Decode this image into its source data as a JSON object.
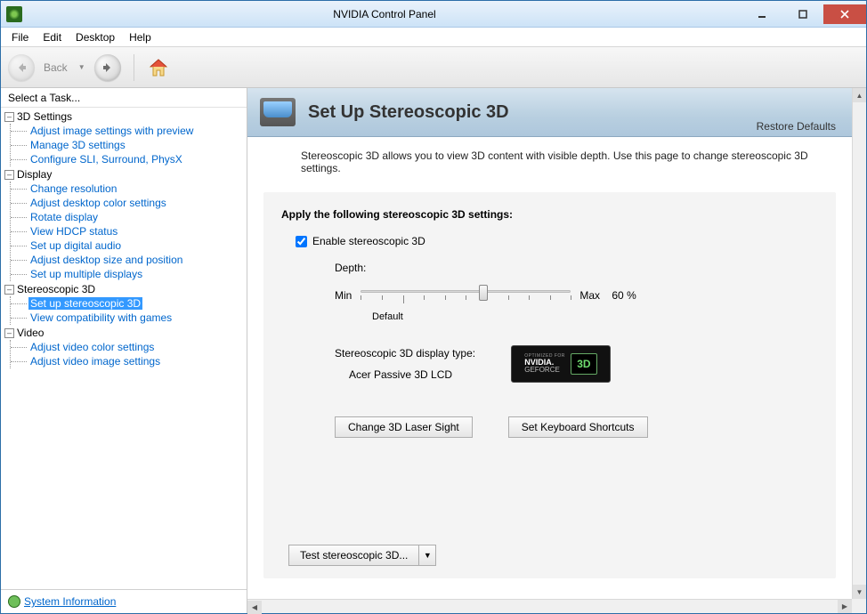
{
  "window": {
    "title": "NVIDIA Control Panel"
  },
  "menubar": [
    "File",
    "Edit",
    "Desktop",
    "Help"
  ],
  "toolbar": {
    "back_label": "Back"
  },
  "sidebar": {
    "title": "Select a Task...",
    "sysinfo_label": "System Information",
    "categories": [
      {
        "label": "3D Settings",
        "items": [
          "Adjust image settings with preview",
          "Manage 3D settings",
          "Configure SLI, Surround, PhysX"
        ]
      },
      {
        "label": "Display",
        "items": [
          "Change resolution",
          "Adjust desktop color settings",
          "Rotate display",
          "View HDCP status",
          "Set up digital audio",
          "Adjust desktop size and position",
          "Set up multiple displays"
        ]
      },
      {
        "label": "Stereoscopic 3D",
        "items": [
          "Set up stereoscopic 3D",
          "View compatibility with games"
        ],
        "selected_index": 0
      },
      {
        "label": "Video",
        "items": [
          "Adjust video color settings",
          "Adjust video image settings"
        ]
      }
    ]
  },
  "page": {
    "title": "Set Up Stereoscopic 3D",
    "restore_label": "Restore Defaults",
    "description": "Stereoscopic 3D allows you to view 3D content with visible depth. Use this page to change stereoscopic 3D settings.",
    "panel_title": "Apply the following stereoscopic 3D settings:",
    "enable_label": "Enable stereoscopic 3D",
    "enable_checked": true,
    "depth": {
      "label": "Depth:",
      "min_label": "Min",
      "max_label": "Max",
      "default_label": "Default",
      "value_pct": 60,
      "value_unit": "%"
    },
    "display_type": {
      "label": "Stereoscopic 3D display type:",
      "value": "Acer Passive 3D LCD"
    },
    "badge": {
      "opt": "OPTIMIZED FOR",
      "line1": "NVIDIA.",
      "line2": "GEFORCE",
      "three_d": "3D"
    },
    "buttons": {
      "laser": "Change 3D Laser Sight",
      "shortcuts": "Set Keyboard Shortcuts",
      "test": "Test stereoscopic 3D..."
    }
  }
}
